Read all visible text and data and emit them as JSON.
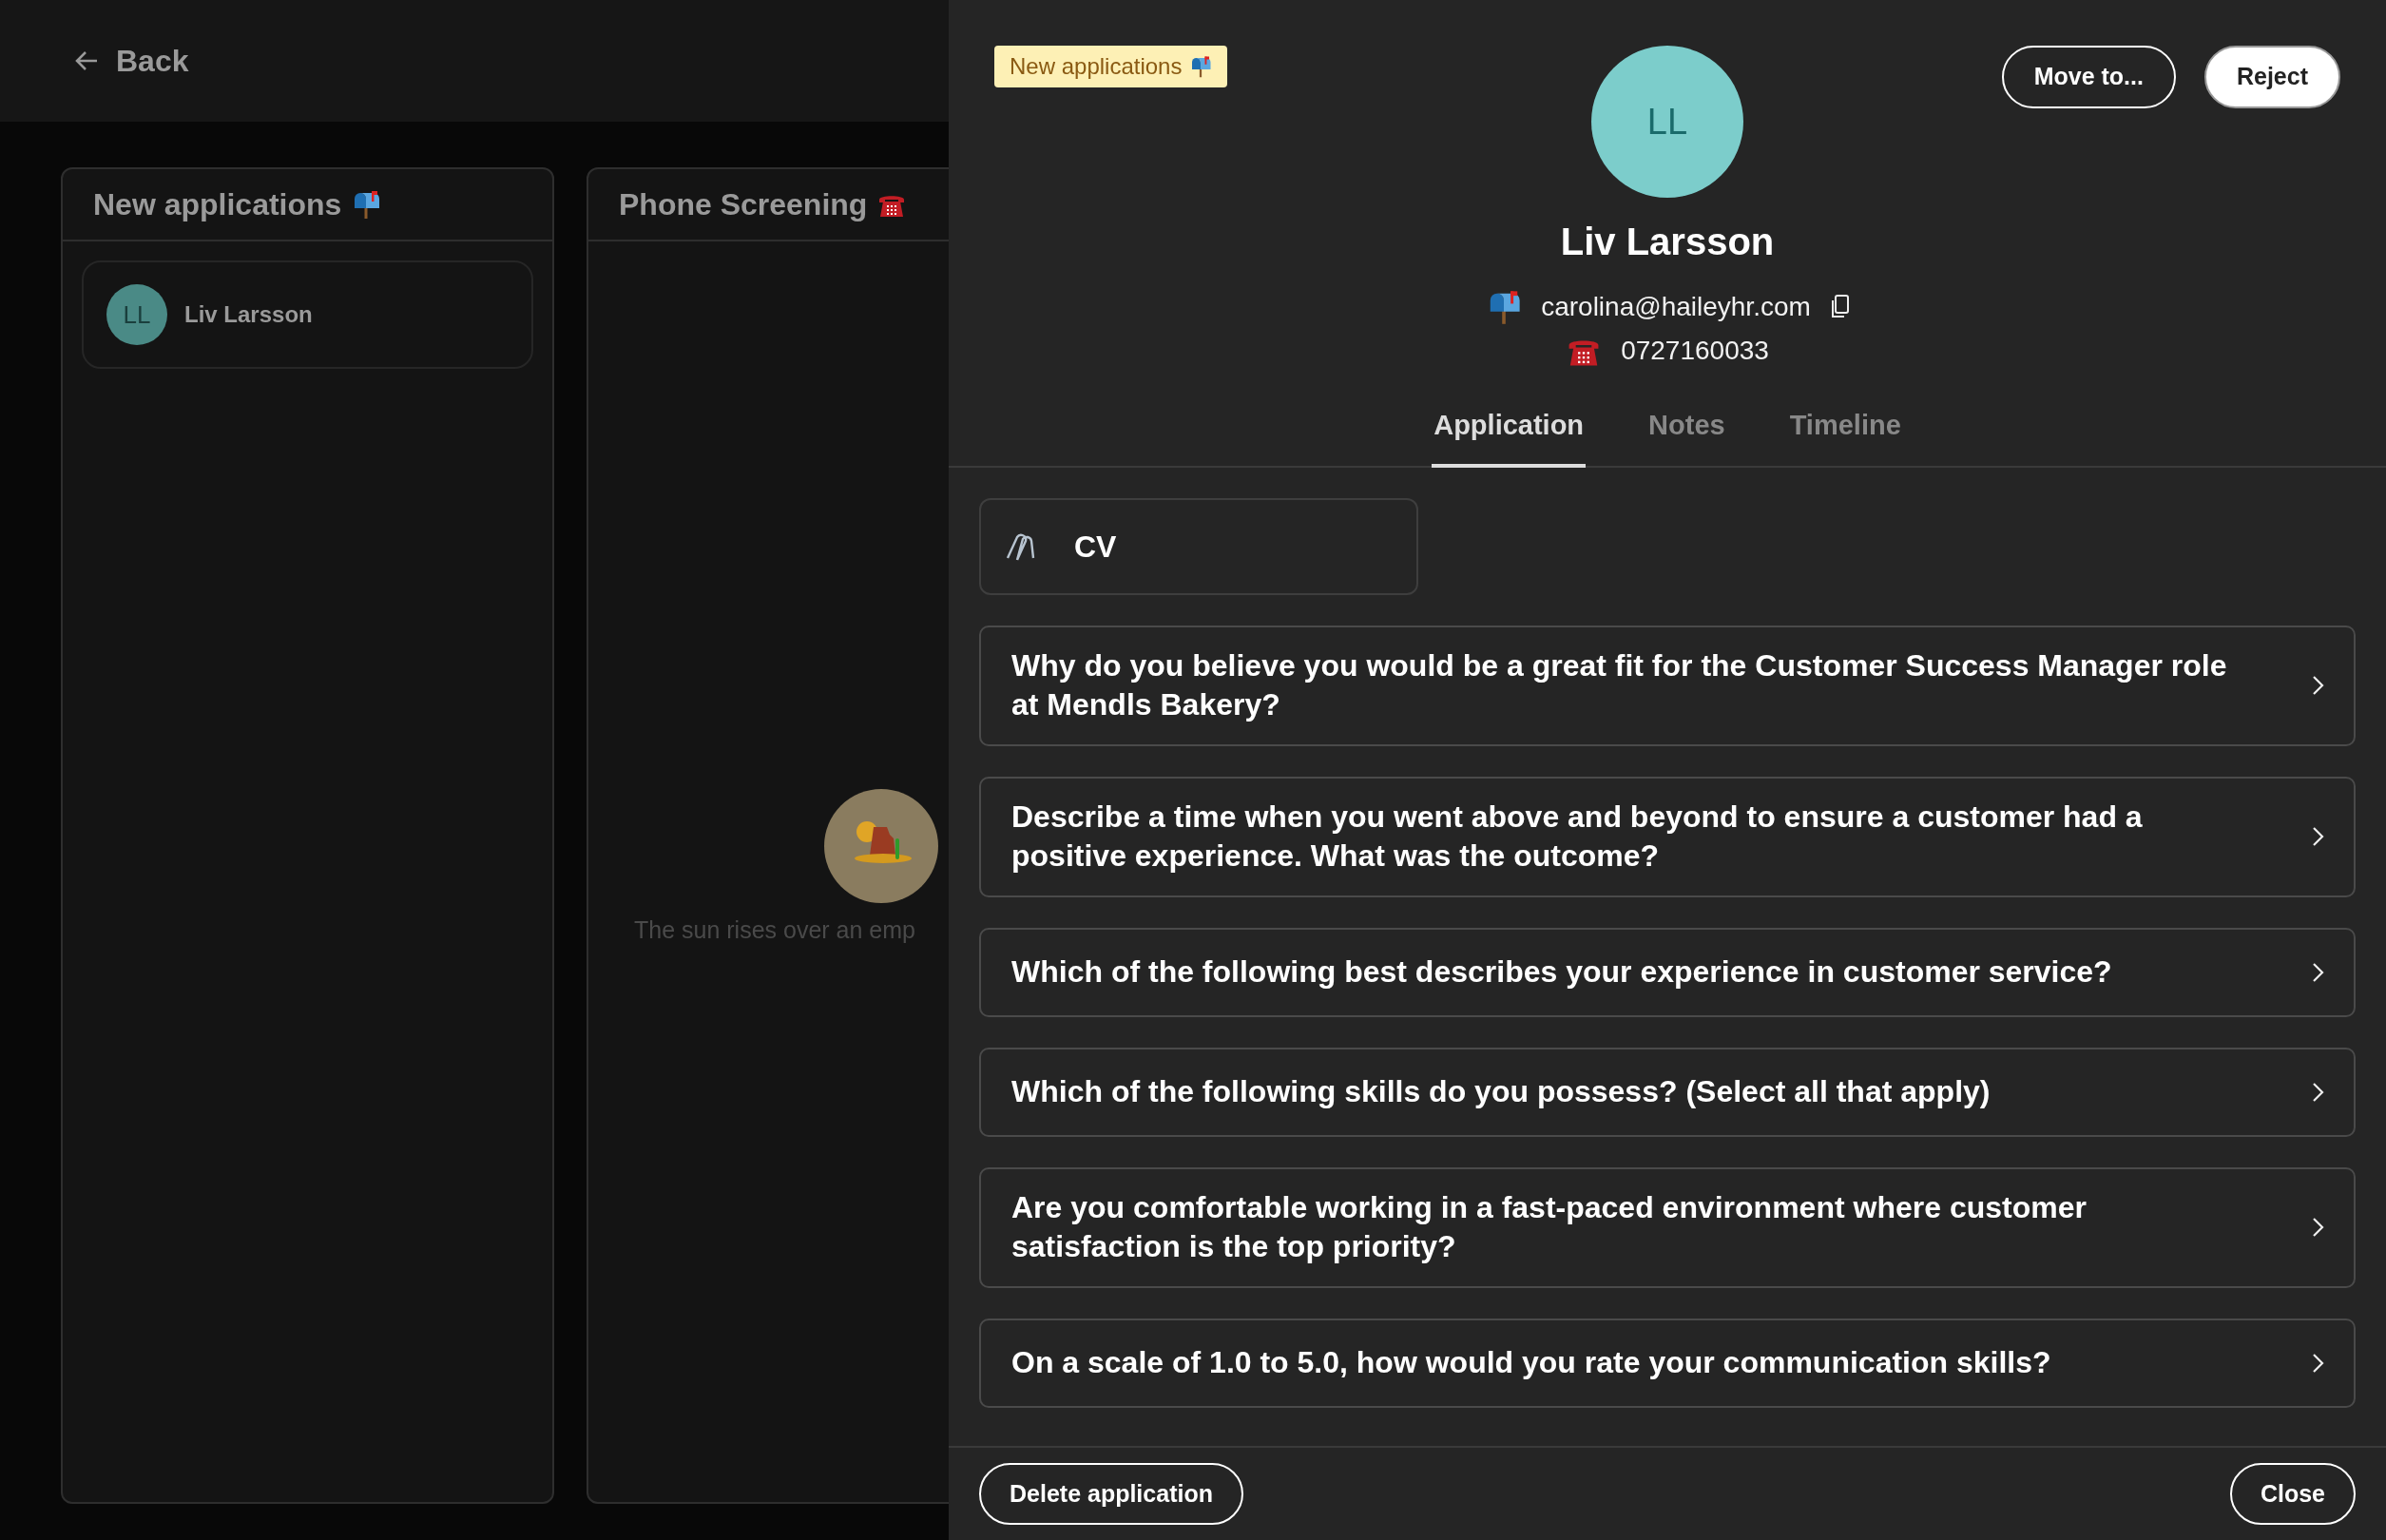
{
  "back": {
    "label": "Back"
  },
  "board": {
    "columns": [
      {
        "title": "New applications",
        "cards": [
          {
            "initials": "LL",
            "name": "Liv Larsson"
          }
        ]
      },
      {
        "title": "Phone Screening",
        "empty_text": "The sun rises over an emp"
      }
    ]
  },
  "panel": {
    "stage_badge": {
      "label": "New applications"
    },
    "actions": [
      {
        "label": "Move to...",
        "kind": "outline"
      },
      {
        "label": "Reject",
        "kind": "filled"
      }
    ],
    "avatar": {
      "initials": "LL"
    },
    "name": "Liv Larsson",
    "contact": [
      {
        "kind": "email",
        "value": "carolina@haileyhr.com"
      },
      {
        "kind": "phone",
        "value": "0727160033"
      }
    ],
    "tabs": [
      {
        "label": "Application",
        "selected": true
      },
      {
        "label": "Notes",
        "selected": false
      },
      {
        "label": "Timeline",
        "selected": false
      }
    ],
    "attachments": [
      {
        "label": "CV"
      }
    ],
    "questions": [
      "Why do you believe you would be a great fit for the Customer Success Manager role at Mendls Bakery?",
      "Describe a time when you went above and beyond to ensure a customer had a positive experience. What was the outcome?",
      "Which of the following best describes your experience in customer service?",
      "Which of the following skills do you possess? (Select all that apply)",
      "Are you comfortable working in a fast-paced environment where customer satisfaction is the top priority?",
      "On a scale of 1.0 to 5.0, how would you rate your communication skills?"
    ],
    "footer": [
      {
        "label": "Delete application"
      },
      {
        "label": "Close"
      }
    ]
  }
}
